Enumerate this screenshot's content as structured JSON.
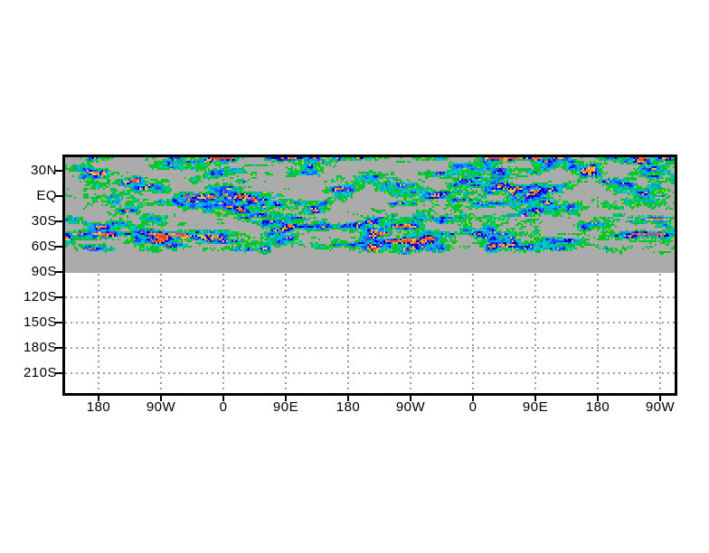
{
  "chart_data": {
    "type": "heatmap",
    "title": "",
    "x_tick_labels": [
      "180",
      "90W",
      "0",
      "90E",
      "180",
      "90W",
      "0",
      "90E",
      "180",
      "90W"
    ],
    "y_tick_labels": [
      "30N",
      "EQ",
      "30S",
      "60S",
      "90S",
      "120S",
      "150S",
      "180S",
      "210S"
    ],
    "grid_style": "dotted",
    "grid_visible_region": "below 90S only",
    "field_extent": "shaded noise field fills band from plot top to about 65S; solid gray background band continues to 90S; below 90S is empty white with dotted grid",
    "colors": {
      "frame": "#000000",
      "tick": "#000000",
      "axis_text": "#000000",
      "grid": "#9c9c9c",
      "field_background_gray": "#ababab"
    },
    "palette": {
      "speckle_green": "#96DC28",
      "green": "#00C828",
      "cyan": "#00C8C8",
      "light_blue": "#0096FF",
      "blue": "#2846FF",
      "dark_blue": "#0000C8",
      "yellow": "#E6C83C",
      "orange": "#F07D28",
      "red": "#E6462D"
    }
  }
}
